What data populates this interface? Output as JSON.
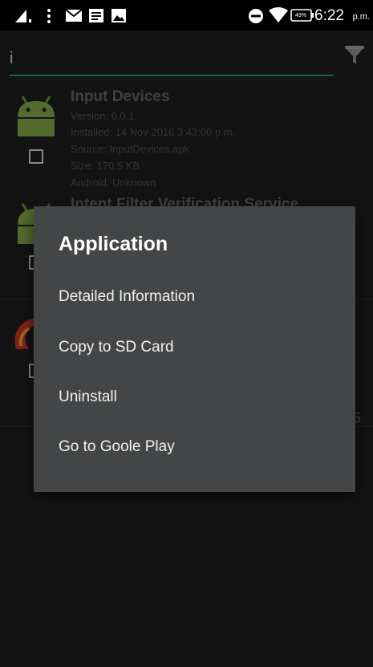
{
  "status_bar": {
    "battery_percent": "49%",
    "clock": "6:22",
    "ampm": "p.m.",
    "icons": [
      "signal-icon",
      "more-vert-icon",
      "mail-icon",
      "notes-icon",
      "image-icon",
      "do-not-disturb-icon",
      "wifi-icon",
      "battery-icon"
    ]
  },
  "search": {
    "value": "i",
    "placeholder": "",
    "underline_color": "#2f8f86"
  },
  "apps": [
    {
      "name": "Input Devices",
      "version": "Version: 6.0.1",
      "installed": "Installed: 14 Nov 2016 3:43:00 p.m.",
      "source": "Source: InputDevices.apk",
      "size": "Size: 170.5 KB",
      "android": "Android: Unknown",
      "icon": "android-robot-icon",
      "checked": false
    },
    {
      "name": "Intent Filter Verification Service",
      "icon": "android-robot-icon",
      "checked": false
    },
    {
      "name": "",
      "trailing_text": "5",
      "icon": "red-app-icon",
      "checked": false
    }
  ],
  "dialog": {
    "title": "Application",
    "options": [
      "Detailed Information",
      "Copy to SD Card",
      "Uninstall",
      "Go to Goole Play"
    ],
    "background_color": "#444546"
  }
}
